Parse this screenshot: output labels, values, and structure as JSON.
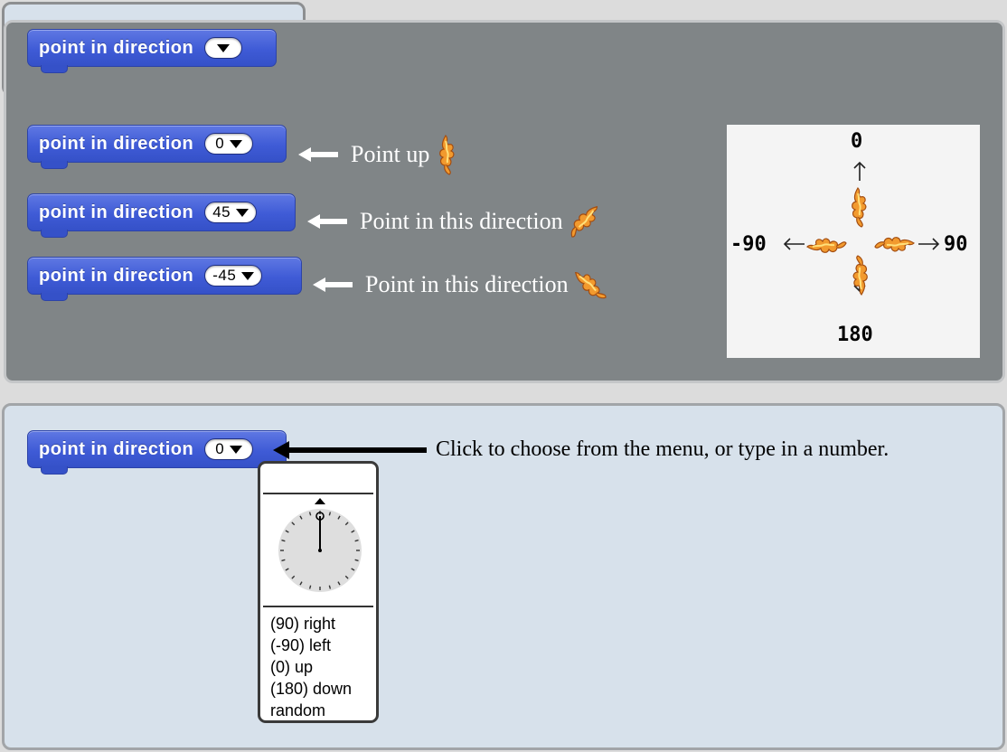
{
  "block": {
    "label": "point in direction"
  },
  "examples": [
    {
      "value": "0",
      "note": "Point up"
    },
    {
      "value": "45",
      "note": "Point in this direction"
    },
    {
      "value": "-45",
      "note": "Point in this direction"
    }
  ],
  "diagram": {
    "up": "0",
    "right": "90",
    "down": "180",
    "left": "-90"
  },
  "interactive": {
    "value": "0",
    "note": "Click to choose from the menu, or type in a number.",
    "menu": {
      "items": [
        "(90) right",
        "(-90) left",
        "(0) up",
        "(180) down",
        "random"
      ]
    }
  },
  "colors": {
    "block": "#3f5bd6",
    "panel_dark": "#808587",
    "panel_light": "#d7e1eb",
    "sprite": "#f29a2e"
  },
  "icons": {
    "sprite": "dragon-sprite-icon",
    "arrow": "arrow-left-icon",
    "dropdown": "dropdown-triangle-icon"
  }
}
